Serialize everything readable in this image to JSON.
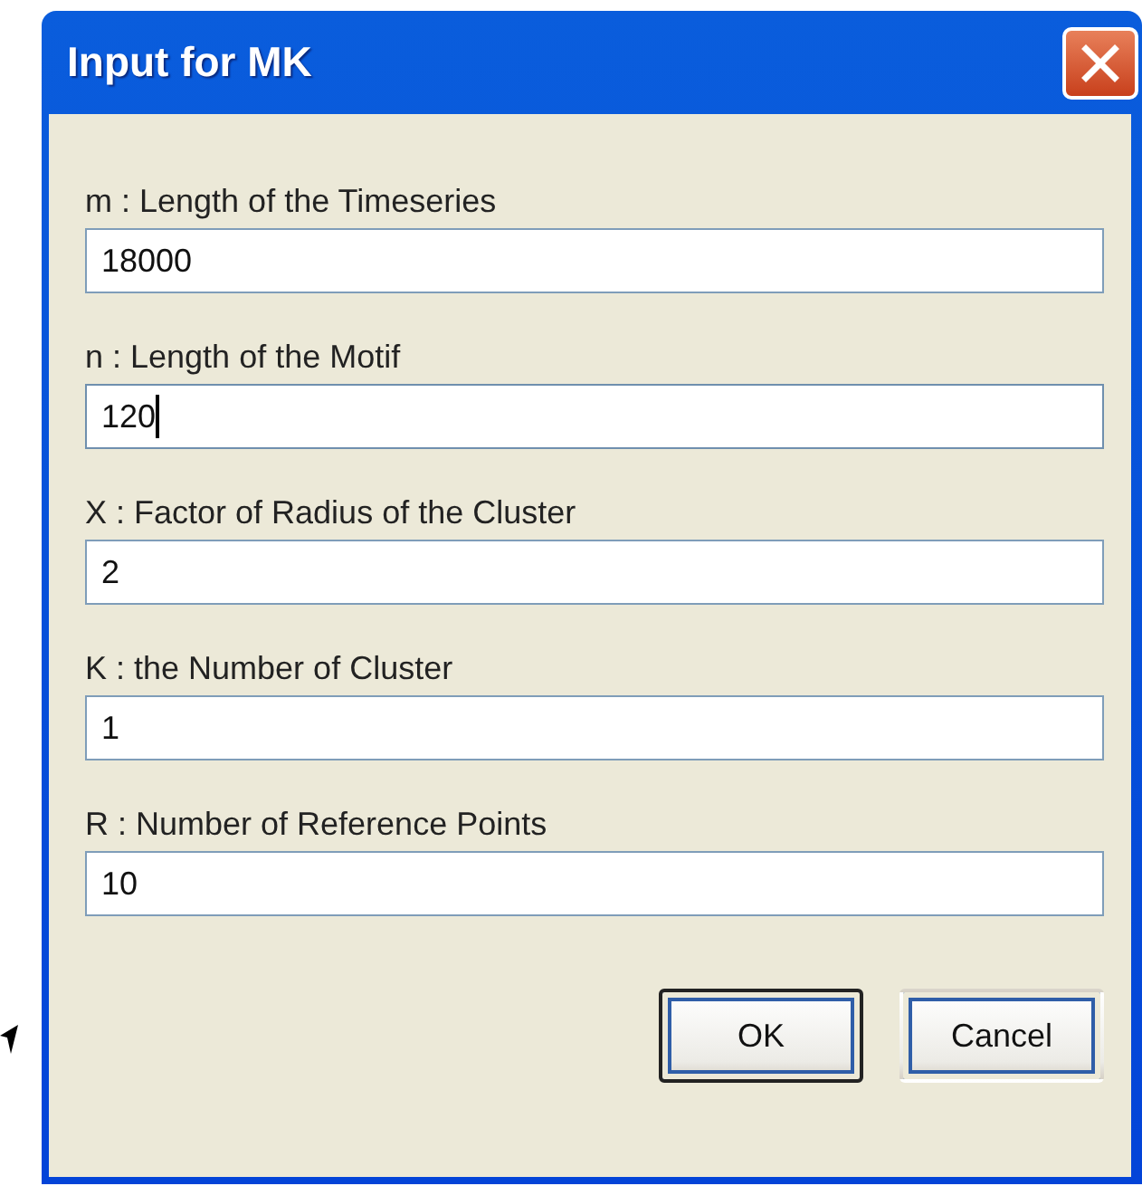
{
  "window": {
    "title": "Input for MK"
  },
  "fields": [
    {
      "label": "m : Length of the Timeseries",
      "value": "18000",
      "focused": false
    },
    {
      "label": "n : Length of the Motif",
      "value": "120",
      "focused": true
    },
    {
      "label": "X : Factor of Radius of the Cluster",
      "value": "2",
      "focused": false
    },
    {
      "label": "K : the Number of Cluster",
      "value": "1",
      "focused": false
    },
    {
      "label": "R : Number of Reference Points",
      "value": "10",
      "focused": false
    }
  ],
  "buttons": [
    {
      "label": "OK",
      "default": true
    },
    {
      "label": "Cancel",
      "default": false
    }
  ]
}
